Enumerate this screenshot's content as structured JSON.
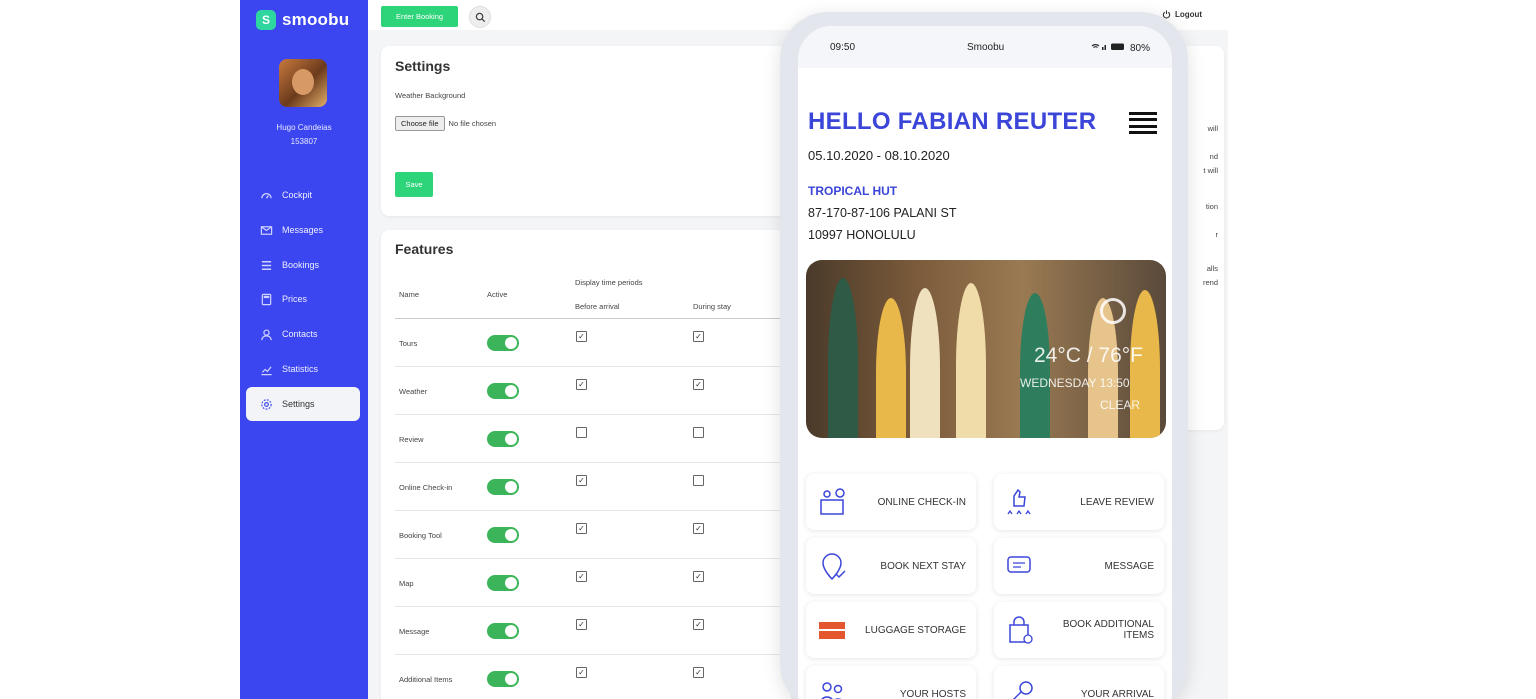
{
  "sidebar": {
    "logo": "smoobu",
    "user_name": "Hugo Candeias",
    "user_id": "153807",
    "items": [
      {
        "label": "Cockpit",
        "icon": "cockpit-icon"
      },
      {
        "label": "Messages",
        "icon": "envelope-icon"
      },
      {
        "label": "Bookings",
        "icon": "list-icon"
      },
      {
        "label": "Prices",
        "icon": "calculator-icon"
      },
      {
        "label": "Contacts",
        "icon": "user-icon"
      },
      {
        "label": "Statistics",
        "icon": "chart-icon"
      },
      {
        "label": "Settings",
        "icon": "gear-icon",
        "active": true
      }
    ]
  },
  "topbar": {
    "enter_booking": "Enter Booking",
    "logout": "Logout"
  },
  "settings": {
    "title": "Settings",
    "weather_label": "Weather Background",
    "choose_file": "Choose file",
    "no_file": "No file chosen",
    "save": "Save"
  },
  "features": {
    "title": "Features",
    "col_name": "Name",
    "col_active": "Active",
    "col_display": "Display time periods",
    "col_before": "Before arrival",
    "col_during": "During stay",
    "rows": [
      {
        "name": "Tours",
        "active": true,
        "before": true,
        "during": true
      },
      {
        "name": "Weather",
        "active": true,
        "before": true,
        "during": true
      },
      {
        "name": "Review",
        "active": true,
        "before": false,
        "during": false
      },
      {
        "name": "Online Check-in",
        "active": true,
        "before": true,
        "during": false
      },
      {
        "name": "Booking Tool",
        "active": true,
        "before": true,
        "during": true
      },
      {
        "name": "Map",
        "active": true,
        "before": true,
        "during": true
      },
      {
        "name": "Message",
        "active": true,
        "before": true,
        "during": true
      },
      {
        "name": "Additional Items",
        "active": true,
        "before": true,
        "during": true
      }
    ]
  },
  "right_card_fragments": [
    "will",
    "nd",
    "t will",
    "tion",
    "r",
    "alls",
    "rend"
  ],
  "phone": {
    "time": "09:50",
    "app": "Smoobu",
    "battery": "80%",
    "greeting": "HELLO FABIAN REUTER",
    "dates": "05.10.2020 - 08.10.2020",
    "property": "TROPICAL HUT",
    "address1": "87-170-87-106 PALANI ST",
    "address2": "10997 HONOLULU",
    "weather_temp": "24°C / 76°F",
    "weather_day": "WEDNESDAY 13:50",
    "weather_cond": "CLEAR",
    "tiles": [
      {
        "label": "ONLINE CHECK-IN",
        "icon": "check-in-desk-icon"
      },
      {
        "label": "LEAVE REVIEW",
        "icon": "thumbs-up-stars-icon"
      },
      {
        "label": "BOOK NEXT STAY",
        "icon": "location-pin-check-icon"
      },
      {
        "label": "MESSAGE",
        "icon": "chat-bubble-icon"
      },
      {
        "label": "LUGGAGE STORAGE",
        "icon": "luggage-storage-icon"
      },
      {
        "label": "BOOK ADDITIONAL ITEMS",
        "icon": "shopping-bag-icon"
      },
      {
        "label": "YOUR HOSTS",
        "icon": "hosts-icon"
      },
      {
        "label": "YOUR ARRIVAL",
        "icon": "key-icon"
      }
    ]
  },
  "colors": {
    "sidebar": "#3b45f0",
    "accent_green": "#2ed47a",
    "phone_heading": "#3b45d8",
    "toggle": "#3cb55a"
  }
}
